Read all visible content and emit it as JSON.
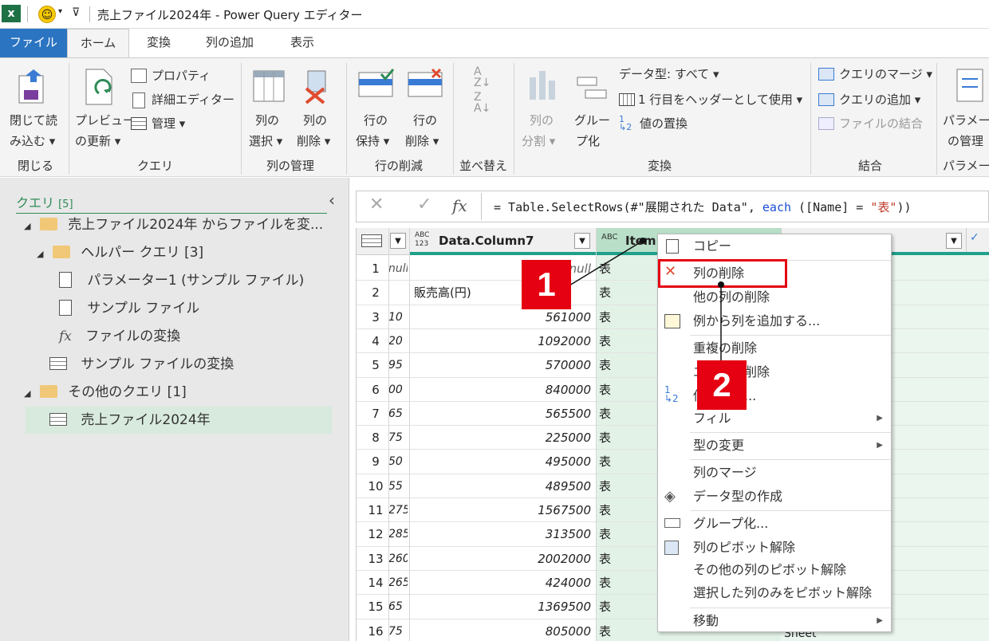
{
  "window": {
    "title": "売上ファイル2024年 - Power Query エディター"
  },
  "tabs": [
    "ファイル",
    "ホーム",
    "変換",
    "列の追加",
    "表示"
  ],
  "ribbon": {
    "close_load": [
      "閉じて読",
      "み込む ▾"
    ],
    "preview": [
      "プレビュー",
      "の更新 ▾"
    ],
    "properties": "プロパティ",
    "advanced_editor": "詳細エディター",
    "manage": "管理 ▾",
    "choose_cols": [
      "列の",
      "選択 ▾"
    ],
    "remove_cols": [
      "列の",
      "削除 ▾"
    ],
    "keep_rows": [
      "行の",
      "保持 ▾"
    ],
    "remove_rows": [
      "行の",
      "削除 ▾"
    ],
    "split": [
      "列の",
      "分割 ▾"
    ],
    "group": [
      "グルー",
      "プ化"
    ],
    "data_type": "データ型: すべて ▾",
    "first_row_header": "1 行目をヘッダーとして使用 ▾",
    "replace_values": "値の置換",
    "merge_queries": "クエリのマージ ▾",
    "append_queries": "クエリの追加 ▾",
    "combine_files": "ファイルの結合",
    "params": [
      "パラメーター",
      "の管理"
    ],
    "groups": {
      "close": "閉じる",
      "query": "クエリ",
      "manage_cols": "列の管理",
      "reduce_rows": "行の削減",
      "sort": "並べ替え",
      "transform": "変換",
      "combine": "結合",
      "params": "パラメーター"
    }
  },
  "queries": {
    "header": "クエリ",
    "count": "[5]",
    "folder1": "売上ファイル2024年 からファイルを変...",
    "helper": "ヘルパー クエリ [3]",
    "param1": "パラメーター1 (サンプル ファイル)",
    "sample": "サンプル ファイル",
    "transform_fn": "ファイルの変換",
    "transform_sample": "サンプル ファイルの変換",
    "other": "その他のクエリ [1]",
    "selected": "売上ファイル2024年"
  },
  "formula": {
    "prefix": "= Table.SelectRows(#\"展開された Data\", ",
    "kw": "each",
    "mid": " ([Name] = ",
    "str": "\"表\"",
    "end": "))"
  },
  "grid": {
    "col1_header": "Data.Column7",
    "col2_header": "Item",
    "col_type_abc123": "ABC\n123",
    "col_type_abc": "ABC",
    "row_nums": [
      "1",
      "2",
      "3",
      "4",
      "5",
      "6",
      "7",
      "8",
      "9",
      "10",
      "11",
      "12",
      "13",
      "14",
      "15",
      "16"
    ],
    "col0": [
      "null",
      "",
      "10",
      "20",
      "95",
      "00",
      "65",
      "75",
      "50",
      "55",
      "275",
      "285",
      "260",
      "265",
      "65",
      "75"
    ],
    "col1": [
      "null",
      "販売高(円)",
      "561000",
      "1092000",
      "570000",
      "840000",
      "565500",
      "225000",
      "495000",
      "489500",
      "1567500",
      "313500",
      "2002000",
      "424000",
      "1369500",
      "805000"
    ],
    "col2": [
      "表",
      "表",
      "表",
      "表",
      "表",
      "表",
      "表",
      "表",
      "表",
      "表",
      "表",
      "表",
      "表",
      "表",
      "表",
      "表"
    ],
    "last_cell": "Sheet"
  },
  "menu": {
    "copy": "コピー",
    "remove_col": "列の削除",
    "remove_other": "他の列の削除",
    "add_from_examples": "例から列を追加する...",
    "remove_dup": "重複の削除",
    "remove_errors": "エラーの削除",
    "replace": "値の置換...",
    "fill": "フィル",
    "change_type": "型の変更",
    "merge_cols": "列のマージ",
    "create_type": "データ型の作成",
    "group_by": "グループ化...",
    "unpivot": "列のピボット解除",
    "unpivot_other": "その他の列のピボット解除",
    "unpivot_selected": "選択した列のみをピボット解除",
    "move": "移動"
  },
  "callouts": [
    "1",
    "2"
  ],
  "colors": {
    "accent": "#2b74c1",
    "excel_green": "#1e7145",
    "selection": "#d8eadd",
    "callout_red": "#e50012",
    "highlight_border": "#e50012"
  }
}
